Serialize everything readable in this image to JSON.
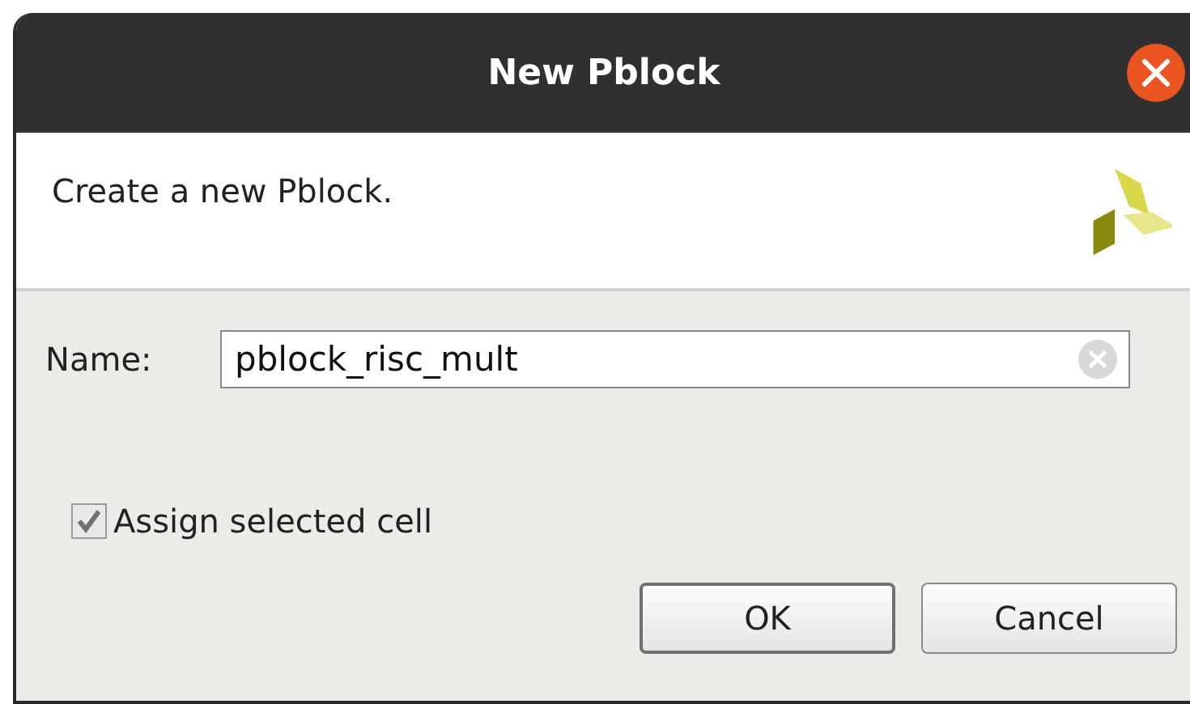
{
  "window": {
    "title": "New Pblock"
  },
  "header": {
    "text": "Create a new Pblock."
  },
  "name_field": {
    "label": "Name:",
    "value": "pblock_risc_mult"
  },
  "assign_checkbox": {
    "label": "Assign selected cell",
    "checked": true
  },
  "buttons": [
    {
      "label": "OK",
      "default": true
    },
    {
      "label": "Cancel",
      "default": false
    }
  ]
}
